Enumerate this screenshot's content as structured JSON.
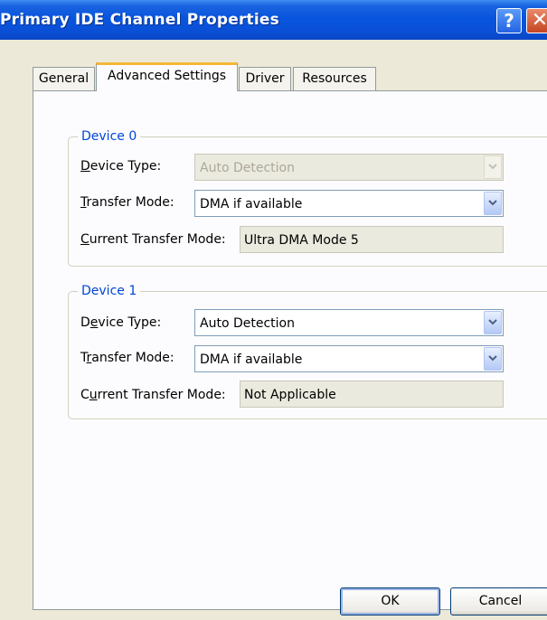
{
  "window": {
    "title": "Primary IDE Channel Properties",
    "help_glyph": "?",
    "close_glyph": "✕",
    "colors": {
      "titlebar": "#0855dd",
      "accent_tab": "#f5b836",
      "legend": "#0046d5",
      "face": "#ece9d8"
    }
  },
  "tabs": [
    {
      "label": "General",
      "active": false
    },
    {
      "label": "Advanced Settings",
      "active": true
    },
    {
      "label": "Driver",
      "active": false
    },
    {
      "label": "Resources",
      "active": false
    }
  ],
  "device0": {
    "legend": "Device 0",
    "device_type": {
      "label_prefix": "",
      "mnemonic": "D",
      "label_rest": "evice Type:",
      "value": "Auto Detection",
      "enabled": false
    },
    "transfer_mode": {
      "label_prefix": "",
      "mnemonic": "T",
      "label_rest": "ransfer Mode:",
      "value": "DMA if available",
      "enabled": true
    },
    "current_mode": {
      "label_prefix": "",
      "mnemonic": "C",
      "label_rest": "urrent Transfer Mode:",
      "value": "Ultra DMA Mode 5"
    }
  },
  "device1": {
    "legend": "Device 1",
    "device_type": {
      "label_prefix": "D",
      "mnemonic": "e",
      "label_rest": "vice Type:",
      "value": "Auto Detection",
      "enabled": true
    },
    "transfer_mode": {
      "label_prefix": "T",
      "mnemonic": "r",
      "label_rest": "ansfer Mode:",
      "value": "DMA if available",
      "enabled": true
    },
    "current_mode": {
      "label_prefix": "C",
      "mnemonic": "u",
      "label_rest": "rrent Transfer Mode:",
      "value": "Not Applicable"
    }
  },
  "buttons": {
    "ok": "OK",
    "cancel": "Cancel"
  }
}
